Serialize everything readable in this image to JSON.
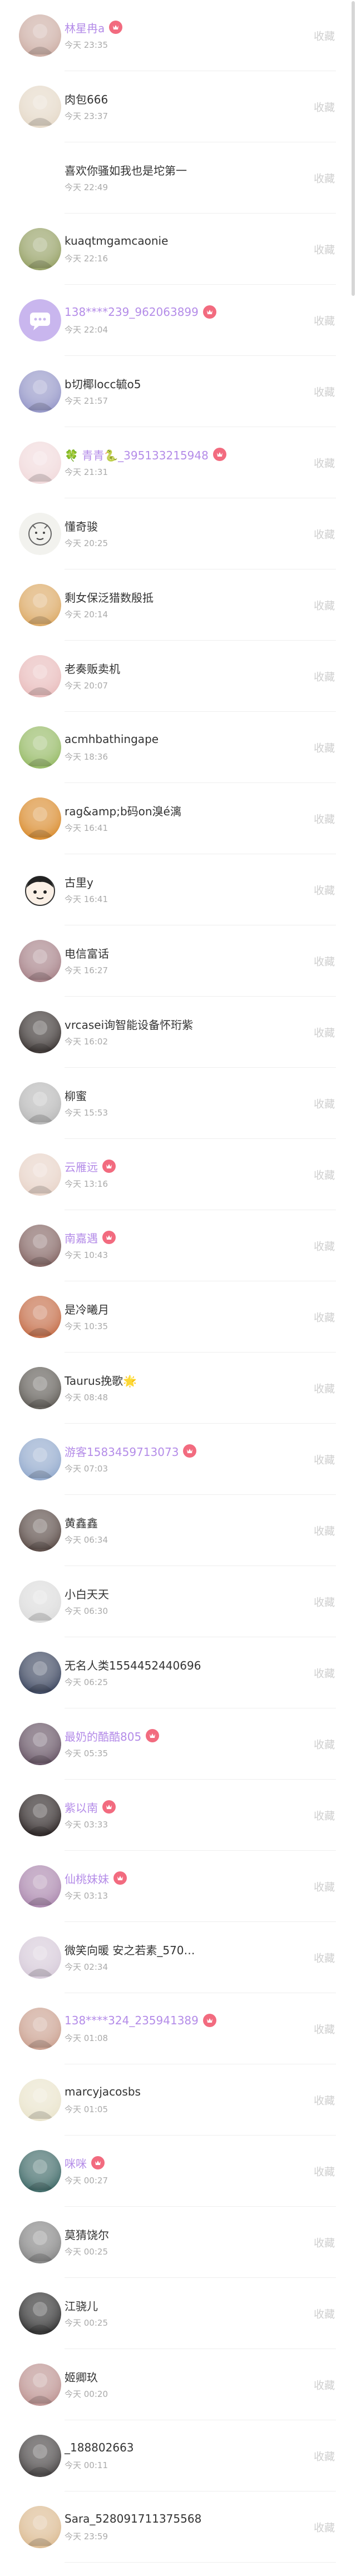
{
  "list": {
    "action_label": "收藏",
    "items": [
      {
        "name": "林星冉a",
        "time": "今天 23:35",
        "vip": true,
        "avatar": "photo-girl-pink",
        "avatar_color": "#c9a89e"
      },
      {
        "name": "肉包666",
        "time": "今天 23:37",
        "vip": false,
        "avatar": "photo-beige",
        "avatar_color": "#e3d6c4"
      },
      {
        "name": "喜欢你骚如我也是坨第一",
        "time": "今天 22:49",
        "vip": false,
        "avatar": "none",
        "avatar_color": "#ffffff"
      },
      {
        "name": "kuaqtmgamcaonie",
        "time": "今天 22:16",
        "vip": false,
        "avatar": "photo-green",
        "avatar_color": "#8e9a5a"
      },
      {
        "name": "138****239_962063899",
        "time": "今天 22:04",
        "vip": true,
        "avatar": "chat-bubble",
        "avatar_color": "#c9b6ee"
      },
      {
        "name": "b切椰locc毓o5",
        "time": "今天 21:57",
        "vip": false,
        "avatar": "photo-blue-purple",
        "avatar_color": "#8d8fc4"
      },
      {
        "name": "🍀 青青🐍_395133215948",
        "time": "今天 21:31",
        "vip": true,
        "avatar": "photo-pink-cartoon",
        "avatar_color": "#f0d7d9"
      },
      {
        "name": "懂奇骏",
        "time": "今天 20:25",
        "vip": false,
        "avatar": "sketch-cartoon",
        "avatar_color": "#f2f2ee"
      },
      {
        "name": "剩女保泛猎数殷抵",
        "time": "今天 20:14",
        "vip": false,
        "avatar": "photo-anime",
        "avatar_color": "#d9a35a"
      },
      {
        "name": "老奏贩卖机",
        "time": "今天 20:07",
        "vip": false,
        "avatar": "photo-pink-girl",
        "avatar_color": "#e7b7b7"
      },
      {
        "name": "acmhbathingape",
        "time": "今天 18:36",
        "vip": false,
        "avatar": "photo-green-yellow",
        "avatar_color": "#8eb55a"
      },
      {
        "name": "rag&amp;b码on溴é漓",
        "time": "今天 16:41",
        "vip": false,
        "avatar": "photo-orange",
        "avatar_color": "#d78420"
      },
      {
        "name": "古里y",
        "time": "今天 16:41",
        "vip": false,
        "avatar": "face-cartoon",
        "avatar_color": "#fbf0e6"
      },
      {
        "name": "电信富话",
        "time": "今天 16:27",
        "vip": false,
        "avatar": "photo-mauve",
        "avatar_color": "#a0787f"
      },
      {
        "name": "vrcasei询智能设备怀珩紫",
        "time": "今天 16:02",
        "vip": false,
        "avatar": "photo-dark-flower",
        "avatar_color": "#2b2422"
      },
      {
        "name": "柳蜜",
        "time": "今天 15:53",
        "vip": false,
        "avatar": "photo-grey-girl",
        "avatar_color": "#b3b3b3"
      },
      {
        "name": "云雁远",
        "time": "今天 13:16",
        "vip": true,
        "avatar": "photo-light-girl",
        "avatar_color": "#e6d0c4"
      },
      {
        "name": "南嘉遇",
        "time": "今天 10:43",
        "vip": true,
        "avatar": "photo-dark-girl",
        "avatar_color": "#7b5a58"
      },
      {
        "name": "是冷曦月",
        "time": "今天 10:35",
        "vip": false,
        "avatar": "photo-red-girl",
        "avatar_color": "#c0623a"
      },
      {
        "name": "Taurus挽歌🌟",
        "time": "今天 08:48",
        "vip": false,
        "avatar": "photo-dark-group",
        "avatar_color": "#54504a"
      },
      {
        "name": "游客1583459713073",
        "time": "今天 07:03",
        "vip": true,
        "avatar": "photo-colorful-anime",
        "avatar_color": "#8aa3c9"
      },
      {
        "name": "黄鑫鑫",
        "time": "今天 06:34",
        "vip": false,
        "avatar": "photo-dark-hair",
        "avatar_color": "#4d3d38"
      },
      {
        "name": "小白天天",
        "time": "今天 06:30",
        "vip": false,
        "avatar": "photo-light-grey",
        "avatar_color": "#d9d9d9"
      },
      {
        "name": "无名人类1554452440696",
        "time": "今天 06:25",
        "vip": false,
        "avatar": "photo-navy",
        "avatar_color": "#2c3752"
      },
      {
        "name": "最奶的酷酷805",
        "time": "今天 05:35",
        "vip": true,
        "avatar": "photo-dark-purple",
        "avatar_color": "#5a4658"
      },
      {
        "name": "紫以南",
        "time": "今天 03:33",
        "vip": true,
        "avatar": "photo-black-red",
        "avatar_color": "#1c1414"
      },
      {
        "name": "仙桃妹妹",
        "time": "今天 03:13",
        "vip": true,
        "avatar": "photo-purple-girl",
        "avatar_color": "#a57fa8"
      },
      {
        "name": "微笑向暖 安之若素_570…",
        "time": "今天 02:34",
        "vip": false,
        "avatar": "photo-pastel",
        "avatar_color": "#d3c6d6"
      },
      {
        "name": "138****324_235941389",
        "time": "今天 01:08",
        "vip": true,
        "avatar": "photo-warm-girl",
        "avatar_color": "#c79a88"
      },
      {
        "name": "marcyjacosbs",
        "time": "今天 01:05",
        "vip": false,
        "avatar": "photo-cream",
        "avatar_color": "#e8e2c8"
      },
      {
        "name": "咪咪",
        "time": "今天 00:27",
        "vip": true,
        "avatar": "photo-teal-dark",
        "avatar_color": "#2f5d5b"
      },
      {
        "name": "莫猜饶尔",
        "time": "今天 00:25",
        "vip": false,
        "avatar": "photo-bw-girl",
        "avatar_color": "#7c7c7c"
      },
      {
        "name": "江骁儿",
        "time": "今天 00:25",
        "vip": false,
        "avatar": "photo-black-figure",
        "avatar_color": "#1f1f1f"
      },
      {
        "name": "姬卿玖",
        "time": "今天 00:20",
        "vip": false,
        "avatar": "photo-rose",
        "avatar_color": "#b88b89"
      },
      {
        "name": "_188802663",
        "time": "今天 00:11",
        "vip": false,
        "avatar": "photo-dark-couple",
        "avatar_color": "#3a3636"
      },
      {
        "name": "Sara_528091711375568",
        "time": "今天 23:59",
        "vip": false,
        "avatar": "photo-sunny-girl",
        "avatar_color": "#d9b68a"
      }
    ]
  }
}
